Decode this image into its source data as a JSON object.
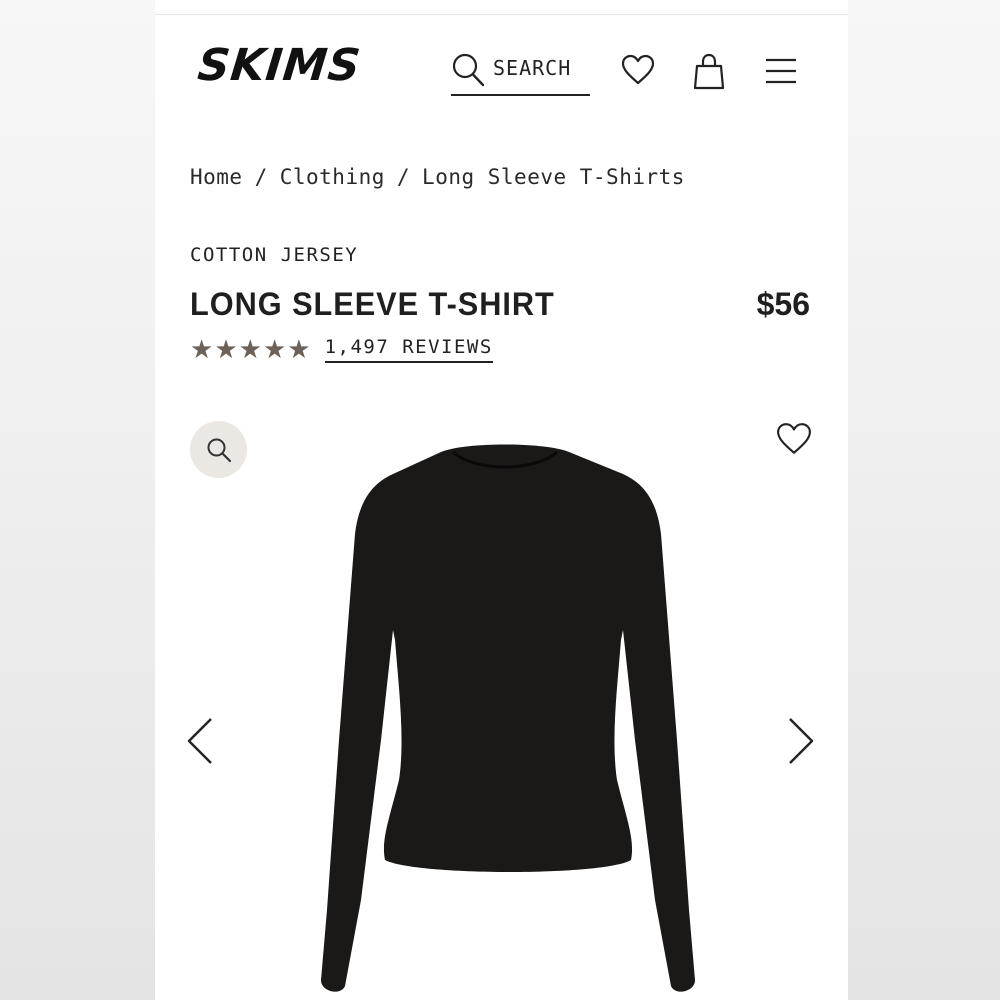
{
  "header": {
    "logo": "SKIMS",
    "search_label": "SEARCH",
    "icons": [
      "search-icon",
      "heart-icon",
      "shopping-bag-icon",
      "hamburger-menu-icon"
    ]
  },
  "breadcrumb": {
    "items": [
      "Home",
      "Clothing",
      "Long Sleeve T-Shirts"
    ],
    "separator": "/"
  },
  "product": {
    "collection": "COTTON JERSEY",
    "name": "LONG SLEEVE T-SHIRT",
    "price": "$56",
    "rating_stars": 5,
    "reviews_label": "1,497 REVIEWS",
    "image_alt": "black long sleeve t-shirt"
  },
  "colors": {
    "accent_text": "#1f1f1f",
    "star": "#6d6259",
    "zoom_button_bg": "#ebe8e3",
    "garment": "#1b1818"
  },
  "gallery_icons": [
    "magnifier-icon",
    "heart-icon",
    "chevron-left-icon",
    "chevron-right-icon"
  ]
}
